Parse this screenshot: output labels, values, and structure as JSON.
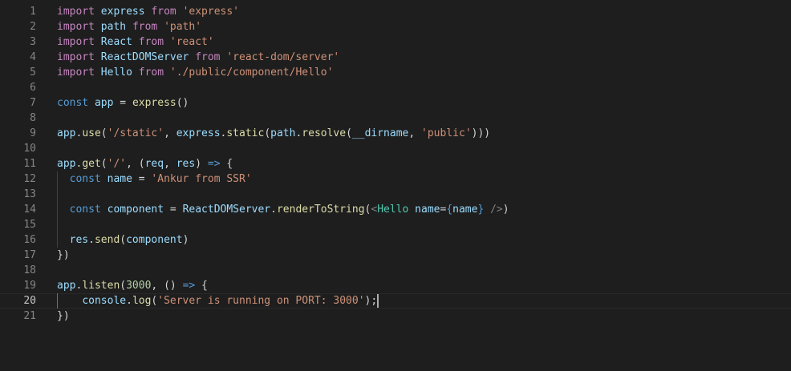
{
  "colors": {
    "keyword": "#c586c0",
    "storage": "#569cd6",
    "variable": "#9cdcfe",
    "function": "#dcdcaa",
    "string": "#ce9178",
    "number": "#b5cea8",
    "plain": "#d4d4d4",
    "tag": "#4ec9b0",
    "tagBracket": "#808080",
    "arrow": "#569cd6"
  },
  "editor": {
    "current_line": 20,
    "lines": [
      {
        "num": "1",
        "indent": 0,
        "tokens": [
          {
            "t": "import",
            "c": "keyword"
          },
          {
            "t": " ",
            "c": "plain"
          },
          {
            "t": "express",
            "c": "variable"
          },
          {
            "t": " ",
            "c": "plain"
          },
          {
            "t": "from",
            "c": "keyword"
          },
          {
            "t": " ",
            "c": "plain"
          },
          {
            "t": "'express'",
            "c": "string"
          }
        ]
      },
      {
        "num": "2",
        "indent": 0,
        "tokens": [
          {
            "t": "import",
            "c": "keyword"
          },
          {
            "t": " ",
            "c": "plain"
          },
          {
            "t": "path",
            "c": "variable"
          },
          {
            "t": " ",
            "c": "plain"
          },
          {
            "t": "from",
            "c": "keyword"
          },
          {
            "t": " ",
            "c": "plain"
          },
          {
            "t": "'path'",
            "c": "string"
          }
        ]
      },
      {
        "num": "3",
        "indent": 0,
        "tokens": [
          {
            "t": "import",
            "c": "keyword"
          },
          {
            "t": " ",
            "c": "plain"
          },
          {
            "t": "React",
            "c": "variable"
          },
          {
            "t": " ",
            "c": "plain"
          },
          {
            "t": "from",
            "c": "keyword"
          },
          {
            "t": " ",
            "c": "plain"
          },
          {
            "t": "'react'",
            "c": "string"
          }
        ]
      },
      {
        "num": "4",
        "indent": 0,
        "tokens": [
          {
            "t": "import",
            "c": "keyword"
          },
          {
            "t": " ",
            "c": "plain"
          },
          {
            "t": "ReactDOMServer",
            "c": "variable"
          },
          {
            "t": " ",
            "c": "plain"
          },
          {
            "t": "from",
            "c": "keyword"
          },
          {
            "t": " ",
            "c": "plain"
          },
          {
            "t": "'react-dom/server'",
            "c": "string"
          }
        ]
      },
      {
        "num": "5",
        "indent": 0,
        "tokens": [
          {
            "t": "import",
            "c": "keyword"
          },
          {
            "t": " ",
            "c": "plain"
          },
          {
            "t": "Hello",
            "c": "variable"
          },
          {
            "t": " ",
            "c": "plain"
          },
          {
            "t": "from",
            "c": "keyword"
          },
          {
            "t": " ",
            "c": "plain"
          },
          {
            "t": "'./public/component/Hello'",
            "c": "string"
          }
        ]
      },
      {
        "num": "6",
        "indent": 0,
        "tokens": []
      },
      {
        "num": "7",
        "indent": 0,
        "tokens": [
          {
            "t": "const",
            "c": "storage"
          },
          {
            "t": " ",
            "c": "plain"
          },
          {
            "t": "app",
            "c": "variable"
          },
          {
            "t": " = ",
            "c": "plain"
          },
          {
            "t": "express",
            "c": "function"
          },
          {
            "t": "()",
            "c": "plain"
          }
        ]
      },
      {
        "num": "8",
        "indent": 0,
        "tokens": []
      },
      {
        "num": "9",
        "indent": 0,
        "tokens": [
          {
            "t": "app",
            "c": "variable"
          },
          {
            "t": ".",
            "c": "plain"
          },
          {
            "t": "use",
            "c": "function"
          },
          {
            "t": "(",
            "c": "plain"
          },
          {
            "t": "'/static'",
            "c": "string"
          },
          {
            "t": ", ",
            "c": "plain"
          },
          {
            "t": "express",
            "c": "variable"
          },
          {
            "t": ".",
            "c": "plain"
          },
          {
            "t": "static",
            "c": "function"
          },
          {
            "t": "(",
            "c": "plain"
          },
          {
            "t": "path",
            "c": "variable"
          },
          {
            "t": ".",
            "c": "plain"
          },
          {
            "t": "resolve",
            "c": "function"
          },
          {
            "t": "(",
            "c": "plain"
          },
          {
            "t": "__dirname",
            "c": "variable"
          },
          {
            "t": ", ",
            "c": "plain"
          },
          {
            "t": "'public'",
            "c": "string"
          },
          {
            "t": ")))",
            "c": "plain"
          }
        ]
      },
      {
        "num": "10",
        "indent": 0,
        "tokens": []
      },
      {
        "num": "11",
        "indent": 0,
        "tokens": [
          {
            "t": "app",
            "c": "variable"
          },
          {
            "t": ".",
            "c": "plain"
          },
          {
            "t": "get",
            "c": "function"
          },
          {
            "t": "(",
            "c": "plain"
          },
          {
            "t": "'/'",
            "c": "string"
          },
          {
            "t": ", (",
            "c": "plain"
          },
          {
            "t": "req",
            "c": "variable"
          },
          {
            "t": ", ",
            "c": "plain"
          },
          {
            "t": "res",
            "c": "variable"
          },
          {
            "t": ") ",
            "c": "plain"
          },
          {
            "t": "=>",
            "c": "arrow"
          },
          {
            "t": " {",
            "c": "plain"
          }
        ]
      },
      {
        "num": "12",
        "indent": 1,
        "tokens": [
          {
            "t": "  ",
            "c": "plain"
          },
          {
            "t": "const",
            "c": "storage"
          },
          {
            "t": " ",
            "c": "plain"
          },
          {
            "t": "name",
            "c": "variable"
          },
          {
            "t": " = ",
            "c": "plain"
          },
          {
            "t": "'Ankur from SSR'",
            "c": "string"
          }
        ]
      },
      {
        "num": "13",
        "indent": 1,
        "tokens": []
      },
      {
        "num": "14",
        "indent": 1,
        "tokens": [
          {
            "t": "  ",
            "c": "plain"
          },
          {
            "t": "const",
            "c": "storage"
          },
          {
            "t": " ",
            "c": "plain"
          },
          {
            "t": "component",
            "c": "variable"
          },
          {
            "t": " = ",
            "c": "plain"
          },
          {
            "t": "ReactDOMServer",
            "c": "variable"
          },
          {
            "t": ".",
            "c": "plain"
          },
          {
            "t": "renderToString",
            "c": "function"
          },
          {
            "t": "(",
            "c": "plain"
          },
          {
            "t": "<",
            "c": "tagBracket"
          },
          {
            "t": "Hello",
            "c": "tag"
          },
          {
            "t": " ",
            "c": "plain"
          },
          {
            "t": "name",
            "c": "variable"
          },
          {
            "t": "=",
            "c": "plain"
          },
          {
            "t": "{",
            "c": "storage"
          },
          {
            "t": "name",
            "c": "variable"
          },
          {
            "t": "}",
            "c": "storage"
          },
          {
            "t": " ",
            "c": "plain"
          },
          {
            "t": "/>",
            "c": "tagBracket"
          },
          {
            "t": ")",
            "c": "plain"
          }
        ]
      },
      {
        "num": "15",
        "indent": 1,
        "tokens": []
      },
      {
        "num": "16",
        "indent": 1,
        "tokens": [
          {
            "t": "  ",
            "c": "plain"
          },
          {
            "t": "res",
            "c": "variable"
          },
          {
            "t": ".",
            "c": "plain"
          },
          {
            "t": "send",
            "c": "function"
          },
          {
            "t": "(",
            "c": "plain"
          },
          {
            "t": "component",
            "c": "variable"
          },
          {
            "t": ")",
            "c": "plain"
          }
        ]
      },
      {
        "num": "17",
        "indent": 0,
        "tokens": [
          {
            "t": "})",
            "c": "plain"
          }
        ]
      },
      {
        "num": "18",
        "indent": 0,
        "tokens": []
      },
      {
        "num": "19",
        "indent": 0,
        "tokens": [
          {
            "t": "app",
            "c": "variable"
          },
          {
            "t": ".",
            "c": "plain"
          },
          {
            "t": "listen",
            "c": "function"
          },
          {
            "t": "(",
            "c": "plain"
          },
          {
            "t": "3000",
            "c": "number"
          },
          {
            "t": ", () ",
            "c": "plain"
          },
          {
            "t": "=>",
            "c": "arrow"
          },
          {
            "t": " {",
            "c": "plain"
          }
        ]
      },
      {
        "num": "20",
        "indent": 2,
        "tokens": [
          {
            "t": "    ",
            "c": "plain"
          },
          {
            "t": "console",
            "c": "variable"
          },
          {
            "t": ".",
            "c": "plain"
          },
          {
            "t": "log",
            "c": "function"
          },
          {
            "t": "(",
            "c": "plain"
          },
          {
            "t": "'Server is running on PORT: 3000'",
            "c": "string"
          },
          {
            "t": ");",
            "c": "plain"
          }
        ]
      },
      {
        "num": "21",
        "indent": 0,
        "tokens": [
          {
            "t": "})",
            "c": "plain"
          }
        ]
      }
    ]
  }
}
